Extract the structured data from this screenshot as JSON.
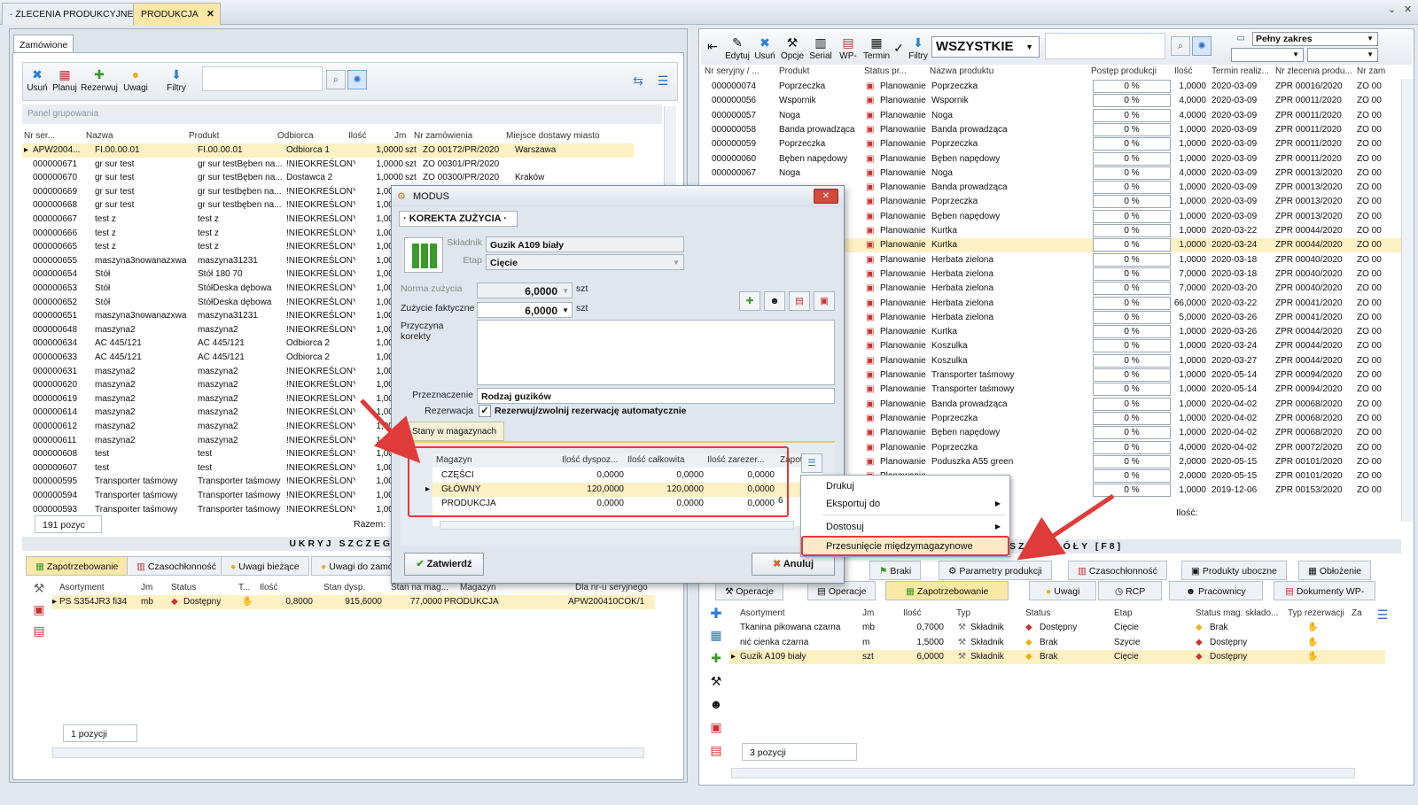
{
  "main_tabs": [
    {
      "label": "· ZLECENIA PRODUKCYJNE ·"
    },
    {
      "label": "PRODUKCJA"
    }
  ],
  "left": {
    "tab": "Zamówione",
    "toolbar": [
      "Usuń",
      "Planuj",
      "Rezerwuj",
      "Uwagi",
      "Filtry"
    ],
    "group_panel": "Panel grupowania",
    "columns": [
      "Nr ser...",
      "Nazwa",
      "Produkt",
      "Odbiorca",
      "Ilość",
      "Jm",
      "Nr zamówienia",
      "Miejsce dostawy miasto"
    ],
    "rows": [
      [
        "APW2004...",
        "FI.00.00.01",
        "FI.00.00.01",
        "Odbiorca 1",
        "1,0000",
        "szt",
        "ZO 00172/PR/2020",
        "Warszawa"
      ],
      [
        "000000671",
        "gr sur test",
        "gr sur testBęben na...",
        "!NIEOKREŚLONY",
        "1,0000",
        "szt",
        "ZO 00301/PR/2020",
        ""
      ],
      [
        "000000670",
        "gr sur test",
        "gr sur testBęben na...",
        "Dostawca 2",
        "1,0000",
        "szt",
        "ZO 00300/PR/2020",
        "Kraków"
      ],
      [
        "000000669",
        "gr sur test",
        "gr sur testbęben na...",
        "!NIEOKREŚLONY",
        "1,0000",
        "",
        "",
        ""
      ],
      [
        "000000668",
        "gr sur test",
        "gr sur testbęben na...",
        "!NIEOKREŚLONY",
        "1,0000",
        "",
        "",
        ""
      ],
      [
        "000000667",
        "test z",
        "test z",
        "!NIEOKREŚLONY",
        "1,0000",
        "",
        "",
        ""
      ],
      [
        "000000666",
        "test z",
        "test z",
        "!NIEOKREŚLONY",
        "1,0000",
        "",
        "",
        ""
      ],
      [
        "000000665",
        "test z",
        "test z",
        "!NIEOKREŚLONY",
        "1,0000",
        "",
        "",
        ""
      ],
      [
        "000000655",
        "maszyna3nowanazxwa",
        "maszyna31231",
        "!NIEOKREŚLONY",
        "1,0000",
        "",
        "",
        ""
      ],
      [
        "000000654",
        "Stół",
        "Stół 180 70",
        "!NIEOKREŚLONY",
        "1,0000",
        "",
        "",
        ""
      ],
      [
        "000000653",
        "Stół",
        "StółDeska dębowa",
        "!NIEOKREŚLONY",
        "1,0000",
        "",
        "",
        ""
      ],
      [
        "000000652",
        "Stół",
        "StółDeska dębowa",
        "!NIEOKREŚLONY",
        "1,0000",
        "",
        "",
        ""
      ],
      [
        "000000651",
        "maszyna3nowanazxwa",
        "maszyna31231",
        "!NIEOKREŚLONY",
        "1,0000",
        "",
        "",
        ""
      ],
      [
        "000000648",
        "maszyna2",
        "maszyna2",
        "!NIEOKREŚLONY",
        "1,0000",
        "",
        "",
        ""
      ],
      [
        "000000634",
        "AC 445/121",
        "AC 445/121",
        "Odbiorca 2",
        "1,0000",
        "",
        "",
        ""
      ],
      [
        "000000633",
        "AC 445/121",
        "AC 445/121",
        "Odbiorca 2",
        "1,0000",
        "",
        "",
        ""
      ],
      [
        "000000631",
        "maszyna2",
        "maszyna2",
        "!NIEOKREŚLONY",
        "1,0000",
        "",
        "",
        ""
      ],
      [
        "000000620",
        "maszyna2",
        "maszyna2",
        "!NIEOKREŚLONY",
        "1,0000",
        "",
        "",
        ""
      ],
      [
        "000000619",
        "maszyna2",
        "maszyna2",
        "!NIEOKREŚLONY",
        "1,0000",
        "",
        "",
        ""
      ],
      [
        "000000614",
        "maszyna2",
        "maszyna2",
        "!NIEOKREŚLONY",
        "1,0000",
        "",
        "",
        ""
      ],
      [
        "000000612",
        "maszyna2",
        "maszyna2",
        "!NIEOKREŚLONY",
        "1,0000",
        "",
        "",
        ""
      ],
      [
        "000000611",
        "maszyna2",
        "maszyna2",
        "!NIEOKREŚLONY",
        "1,0000",
        "",
        "",
        ""
      ],
      [
        "000000608",
        "test",
        "test",
        "!NIEOKREŚLONY",
        "1,0000",
        "",
        "",
        ""
      ],
      [
        "000000607",
        "test",
        "test",
        "!NIEOKREŚLONY",
        "1,0000",
        "",
        "",
        ""
      ],
      [
        "000000595",
        "Transporter taśmowy",
        "Transporter taśmowy",
        "!NIEOKREŚLONY",
        "1,0000",
        "",
        "",
        ""
      ],
      [
        "000000594",
        "Transporter taśmowy",
        "Transporter taśmowy",
        "!NIEOKREŚLONY",
        "1,0000",
        "",
        "",
        ""
      ],
      [
        "000000593",
        "Transporter taśmowy",
        "Transporter taśmowy",
        "!NIEOKREŚLONY",
        "1,0000",
        "",
        "",
        ""
      ]
    ],
    "count": "191 pozyc",
    "razem": "Razem:",
    "hide_details": "UKRYJ SZCZEGÓŁ",
    "sub_tabs": [
      "Zapotrzebowanie",
      "Czasochłonność",
      "Uwagi bieżące",
      "Uwagi do zamów"
    ],
    "sub_columns": [
      "Asortyment",
      "Jm",
      "Status",
      "T...",
      "Ilość",
      "Stan dysp.",
      "Stan na mag...",
      "Magazyn",
      "Dla nr-u seryjnego"
    ],
    "sub_row": [
      "PS S354JR3 fi34",
      "mb",
      "Dostępny",
      "",
      "0,8000",
      "915,6000",
      "77,0000",
      "PRODUKCJA",
      "APW200410COK/1"
    ],
    "sub_count": "1 pozycji"
  },
  "right": {
    "toolbar": [
      "Edytuj",
      "Usuń",
      "Opcje",
      "Serial",
      "WP-",
      "Termin",
      "Filtry"
    ],
    "filter_value": "WSZYSTKIE",
    "range_value": "Pełny zakres",
    "columns": [
      "Nr seryjny / ...",
      "Produkt",
      "Status pr...",
      "Nazwa produktu",
      "Postęp produkcji",
      "Ilość",
      "Termin realiz...",
      "Nr zlecenia produ...",
      "Nr zam"
    ],
    "rows": [
      [
        "000000074",
        "Poprzeczka",
        "Planowanie",
        "Poprzeczka",
        "0 %",
        "1,0000",
        "2020-03-09",
        "ZPR 00016/2020",
        "ZO 00"
      ],
      [
        "000000056",
        "Wspornik",
        "Planowanie",
        "Wspornik",
        "0 %",
        "4,0000",
        "2020-03-09",
        "ZPR 00011/2020",
        "ZO 00"
      ],
      [
        "000000057",
        "Noga",
        "Planowanie",
        "Noga",
        "0 %",
        "4,0000",
        "2020-03-09",
        "ZPR 00011/2020",
        "ZO 00"
      ],
      [
        "000000058",
        "Banda prowadząca",
        "Planowanie",
        "Banda prowadząca",
        "0 %",
        "1,0000",
        "2020-03-09",
        "ZPR 00011/2020",
        "ZO 00"
      ],
      [
        "000000059",
        "Poprzeczka",
        "Planowanie",
        "Poprzeczka",
        "0 %",
        "1,0000",
        "2020-03-09",
        "ZPR 00011/2020",
        "ZO 00"
      ],
      [
        "000000060",
        "Bęben napędowy",
        "Planowanie",
        "Bęben napędowy",
        "0 %",
        "1,0000",
        "2020-03-09",
        "ZPR 00011/2020",
        "ZO 00"
      ],
      [
        "000000067",
        "Noga",
        "Planowanie",
        "Noga",
        "0 %",
        "4,0000",
        "2020-03-09",
        "ZPR 00013/2020",
        "ZO 00"
      ],
      [
        "",
        "",
        "Planowanie",
        "Banda prowadząca",
        "0 %",
        "1,0000",
        "2020-03-09",
        "ZPR 00013/2020",
        "ZO 00"
      ],
      [
        "",
        "",
        "Planowanie",
        "Poprzeczka",
        "0 %",
        "1,0000",
        "2020-03-09",
        "ZPR 00013/2020",
        "ZO 00"
      ],
      [
        "",
        "",
        "Planowanie",
        "Bęben napędowy",
        "0 %",
        "1,0000",
        "2020-03-09",
        "ZPR 00013/2020",
        "ZO 00"
      ],
      [
        "",
        "",
        "Planowanie",
        "Kurtka",
        "0 %",
        "1,0000",
        "2020-03-22",
        "ZPR 00044/2020",
        "ZO 00"
      ],
      [
        "",
        "",
        "Planowanie",
        "Kurtka",
        "0 %",
        "1,0000",
        "2020-03-24",
        "ZPR 00044/2020",
        "ZO 00"
      ],
      [
        "",
        "",
        "Planowanie",
        "Herbata zielona",
        "0 %",
        "1,0000",
        "2020-03-18",
        "ZPR 00040/2020",
        "ZO 00"
      ],
      [
        "",
        "",
        "Planowanie",
        "Herbata zielona",
        "0 %",
        "7,0000",
        "2020-03-18",
        "ZPR 00040/2020",
        "ZO 00"
      ],
      [
        "",
        "",
        "Planowanie",
        "Herbata zielona",
        "0 %",
        "7,0000",
        "2020-03-20",
        "ZPR 00040/2020",
        "ZO 00"
      ],
      [
        "",
        "",
        "Planowanie",
        "Herbata zielona",
        "0 %",
        "66,0000",
        "2020-03-22",
        "ZPR 00041/2020",
        "ZO 00"
      ],
      [
        "",
        "",
        "Planowanie",
        "Herbata zielona",
        "0 %",
        "5,0000",
        "2020-03-26",
        "ZPR 00041/2020",
        "ZO 00"
      ],
      [
        "",
        "",
        "Planowanie",
        "Kurtka",
        "0 %",
        "1,0000",
        "2020-03-26",
        "ZPR 00044/2020",
        "ZO 00"
      ],
      [
        "",
        "",
        "Planowanie",
        "Koszulka",
        "0 %",
        "1,0000",
        "2020-03-24",
        "ZPR 00044/2020",
        "ZO 00"
      ],
      [
        "",
        "",
        "Planowanie",
        "Koszulka",
        "0 %",
        "1,0000",
        "2020-03-27",
        "ZPR 00044/2020",
        "ZO 00"
      ],
      [
        "",
        "",
        "Planowanie",
        "Transporter taśmowy",
        "0 %",
        "1,0000",
        "2020-05-14",
        "ZPR 00094/2020",
        "ZO 00"
      ],
      [
        "",
        "",
        "Planowanie",
        "Transporter taśmowy",
        "0 %",
        "1,0000",
        "2020-05-14",
        "ZPR 00094/2020",
        "ZO 00"
      ],
      [
        "",
        "",
        "Planowanie",
        "Banda prowadząca",
        "0 %",
        "1,0000",
        "2020-04-02",
        "ZPR 00068/2020",
        "ZO 00"
      ],
      [
        "",
        "",
        "Planowanie",
        "Poprzeczka",
        "0 %",
        "1,0000",
        "2020-04-02",
        "ZPR 00068/2020",
        "ZO 00"
      ],
      [
        "",
        "",
        "Planowanie",
        "Bęben napędowy",
        "0 %",
        "1,0000",
        "2020-04-02",
        "ZPR 00068/2020",
        "ZO 00"
      ],
      [
        "",
        "",
        "Planowanie",
        "Poprzeczka",
        "0 %",
        "4,0000",
        "2020-04-02",
        "ZPR 00072/2020",
        "ZO 00"
      ],
      [
        "",
        "",
        "Planowanie",
        "Poduszka A55 green",
        "0 %",
        "2,0000",
        "2020-05-15",
        "ZPR 00101/2020",
        "ZO 00"
      ],
      [
        "",
        "",
        "Planowanie",
        "",
        "0 %",
        "2,0000",
        "2020-05-15",
        "ZPR 00101/2020",
        "ZO 00"
      ],
      [
        "",
        "",
        "",
        "",
        "0 %",
        "1,0000",
        "2019-12-06",
        "ZPR 00153/2020",
        "ZO 00"
      ]
    ],
    "ilosc_label": "Ilość:",
    "details_header": "SZCZEGÓŁY [F8]",
    "tabs_row1": [
      "Braki",
      "Parametry produkcji",
      "Czasochłonność",
      "Produkty uboczne",
      "Obłożenie"
    ],
    "tabs_row2": [
      "Operacje",
      "Operacje",
      "Zapotrzebowanie",
      "Uwagi",
      "RCP",
      "Pracownicy",
      "Dokumenty WP-"
    ],
    "sub_columns": [
      "Asortyment",
      "Jm",
      "Ilość",
      "Typ",
      "Status",
      "Etap",
      "Status mag. składo...",
      "Typ rezerwacji",
      "Za"
    ],
    "sub_rows": [
      [
        "Tkanina pikowana czarna",
        "mb",
        "0,7000",
        "Składnik",
        "Dostępny",
        "Cięcie",
        "Brak"
      ],
      [
        "nić cienka czarna",
        "m",
        "1,5000",
        "Składnik",
        "Brak",
        "Szycie",
        "Dostępny"
      ],
      [
        "Guzik A109 biały",
        "szt",
        "6,0000",
        "Składnik",
        "Brak",
        "Cięcie",
        "Dostępny"
      ]
    ],
    "sub_count": "3 pozycji"
  },
  "dialog": {
    "title": "MODUS",
    "section": "· KOREKTA ZUŻYCIA ·",
    "skladnik_label": "Składnik",
    "skladnik_value": "Guzik A109 biały",
    "etap_label": "Etap",
    "etap_value": "Cięcie",
    "norma_label": "Norma zużycia",
    "norma_value": "6,0000",
    "faktyczne_label": "Zużycie faktyczne",
    "faktyczne_value": "6,0000",
    "unit": "szt",
    "przyczyna_label": "Przyczyna korekty",
    "przeznaczenie_label": "Przeznaczenie",
    "przeznaczenie_value": "Rodzaj guzików",
    "rezerwacja_label": "Rezerwacja",
    "rezerwacja_value": "Rezerwuj/zwolnij rezerwację automatycznie",
    "stock_tab": "Stany w magazynach",
    "stock_columns": [
      "Magazyn",
      "Ilość dyspoz...",
      "Ilość całkowita",
      "Ilość zarezer...",
      "Zapot"
    ],
    "stock_rows": [
      [
        "CZĘŚCI",
        "0,0000",
        "0,0000",
        "0,0000"
      ],
      [
        "GŁÓWNY",
        "120,0000",
        "120,0000",
        "0,0000"
      ],
      [
        "PRODUKCJA",
        "0,0000",
        "0,0000",
        "0,0000"
      ]
    ],
    "stock_extra": "6",
    "confirm": "Zatwierdź",
    "cancel": "Anuluj"
  },
  "context_menu": [
    "Drukuj",
    "Eksportuj do",
    "Dostosuj",
    "Przesunięcie międzymagazynowe"
  ],
  "colors": {
    "accent": "#fbe7a6",
    "highlight_red": "#e03b3b",
    "grid_selected": "#fdf0c2"
  }
}
